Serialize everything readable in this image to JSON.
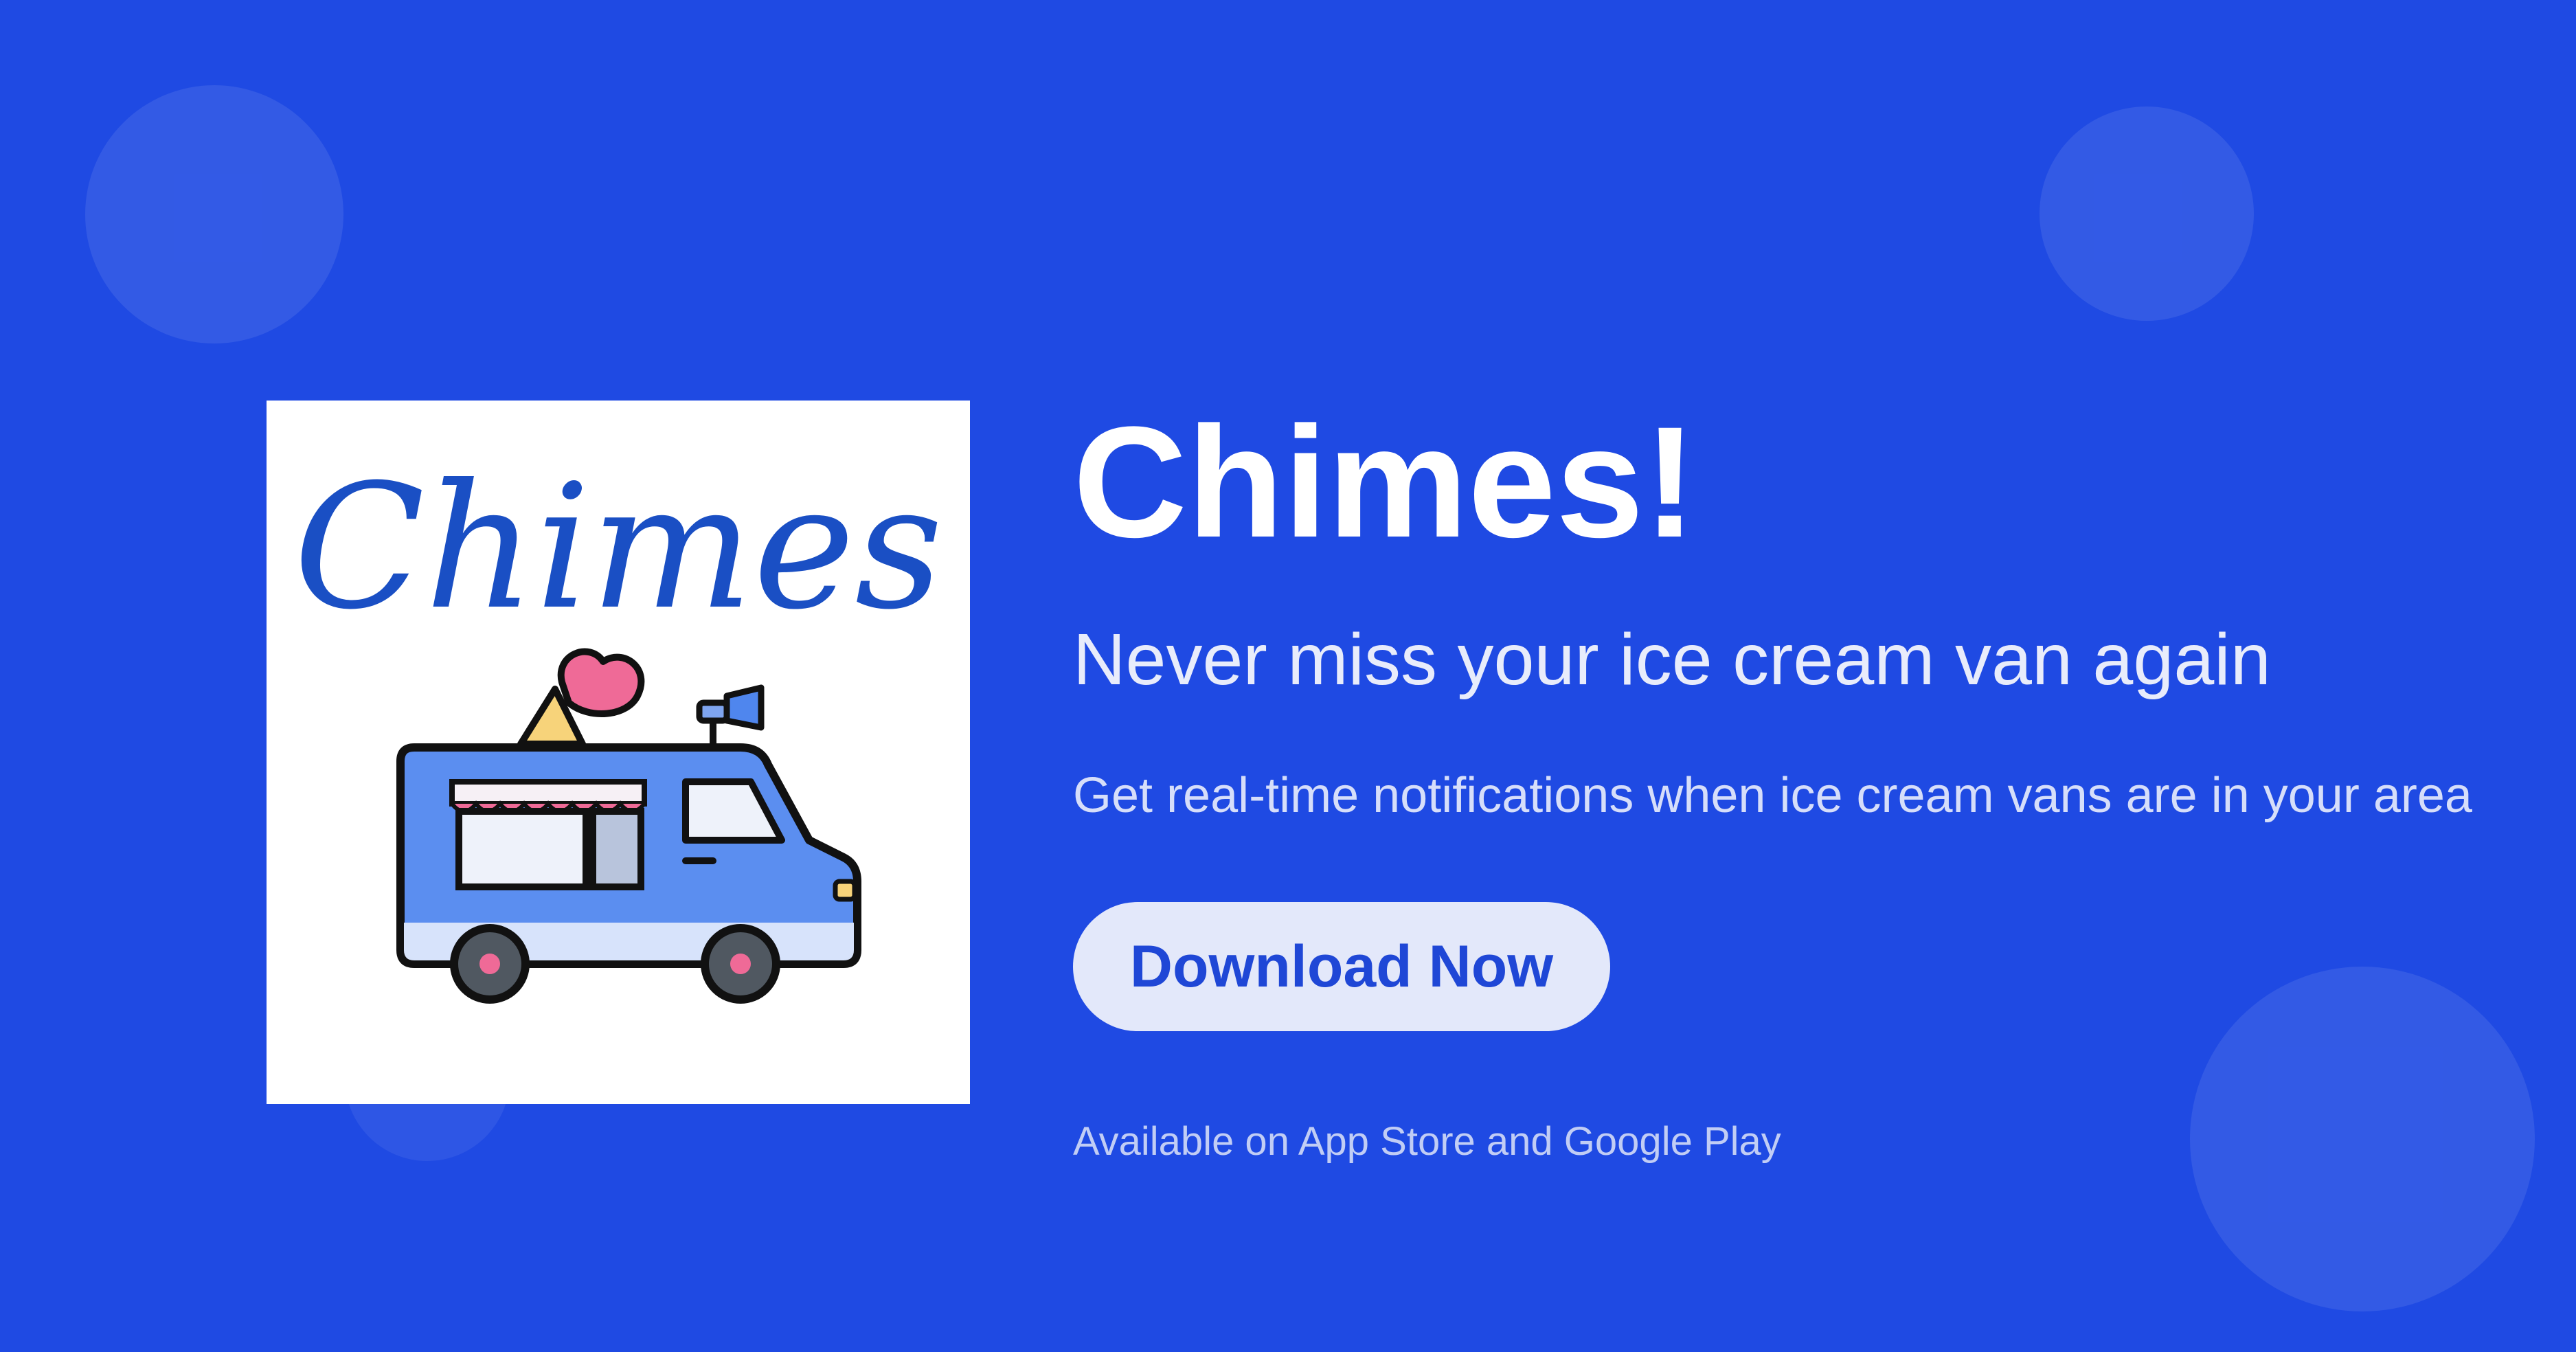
{
  "logo": {
    "wordmark": "Chimes",
    "icon": "ice-cream-van-icon"
  },
  "hero": {
    "title": "Chimes!",
    "subtitle": "Never miss your ice cream van again",
    "description": "Get real-time notifications when ice cream vans are in your area"
  },
  "cta": {
    "download_label": "Download Now"
  },
  "footer": {
    "availability": "Available on App Store and Google Play"
  },
  "colors": {
    "background": "#1f4ae3",
    "button_bg": "#e3e8fa",
    "button_text": "#1f47d6",
    "logo_wordmark": "#1a4fc4"
  }
}
